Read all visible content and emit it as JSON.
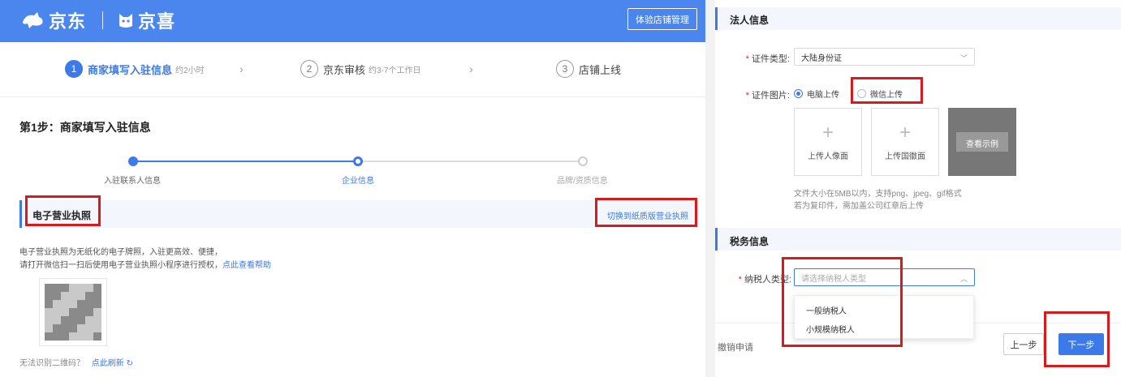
{
  "header": {
    "brand1": "京东",
    "brand2": "京喜",
    "manage_button": "体验店铺管理",
    "brand_color": "#4a86ee"
  },
  "top_steps": [
    {
      "num": "1",
      "label": "商家填写入驻信息",
      "hint": "约2小时"
    },
    {
      "num": "2",
      "label": "京东审核",
      "hint": "约3-7个工作日"
    },
    {
      "num": "3",
      "label": "店铺上线",
      "hint": ""
    }
  ],
  "step_title": "第1步：商家填写入驻信息",
  "progress": [
    {
      "label": "入驻联系人信息",
      "state": "done"
    },
    {
      "label": "企业信息",
      "state": "current"
    },
    {
      "label": "品牌/资质信息",
      "state": "todo"
    }
  ],
  "license": {
    "title": "电子营业执照",
    "switch_link": "切换到纸质版营业执照",
    "desc1": "电子营业执照为无纸化的电子牌照，入驻更高效、便捷，",
    "desc2": "请打开微信扫一扫后使用电子营业执照小程序进行授权，",
    "help_link": "点此查看帮助",
    "refresh_text": "无法识别二维码？",
    "refresh_link": "点此刷新"
  },
  "legal": {
    "title": "法人信息",
    "id_type_label": "证件类型:",
    "id_type_value": "大陆身份证",
    "id_image_label": "证件图片:",
    "radio_pc": "电脑上传",
    "radio_wechat": "微信上传",
    "upload_front": "上传人像面",
    "upload_back": "上传国徽面",
    "sample_label": "查看示例",
    "hint1": "文件大小在5MB以内，支持png、jpeg、gif格式",
    "hint2": "若为复印件，需加盖公司红章后上传"
  },
  "tax": {
    "title": "税务信息",
    "taxpayer_label": "纳税人类型:",
    "taxpayer_placeholder": "请选择纳税人类型",
    "options": [
      "一般纳税人",
      "小规模纳税人"
    ]
  },
  "footer": {
    "cancel": "撤销申请",
    "prev": "上一步",
    "next": "下一步"
  },
  "colors": {
    "accent": "#3b7ae8",
    "highlight_box": "#d91a1a"
  }
}
